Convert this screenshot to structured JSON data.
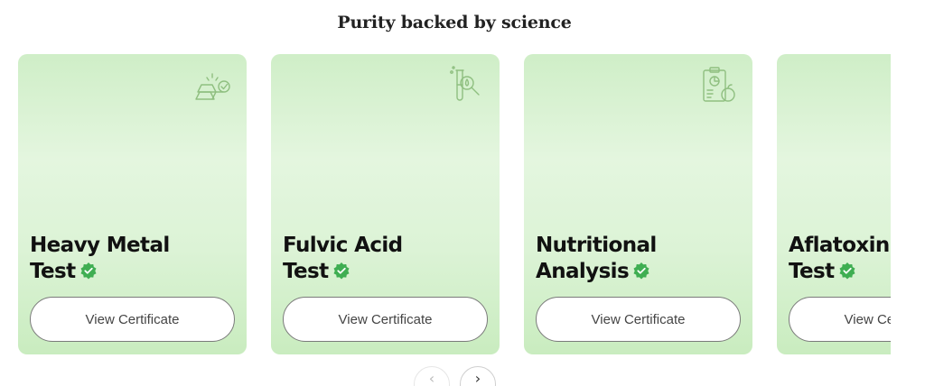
{
  "section": {
    "title": "Purity backed by science"
  },
  "cards": [
    {
      "title_line1": "Heavy Metal",
      "title_line2": "Test",
      "button_label": "View Certificate",
      "icon": "gold-bars-check-icon"
    },
    {
      "title_line1": "Fulvic Acid",
      "title_line2": "Test",
      "button_label": "View Certificate",
      "icon": "test-tube-magnifier-icon"
    },
    {
      "title_line1": "Nutritional",
      "title_line2": "Analysis",
      "button_label": "View Certificate",
      "icon": "nutrition-report-icon"
    },
    {
      "title_line1": "Aflatoxin",
      "title_line2": "Test",
      "button_label": "View Certificate",
      "icon": "lab-icon"
    }
  ],
  "navigation": {
    "prev_label": "‹",
    "next_label": "›"
  },
  "colors": {
    "card_green": "#dcf3d6",
    "badge_green": "#3fae52",
    "icon_green": "#8fbf80"
  }
}
